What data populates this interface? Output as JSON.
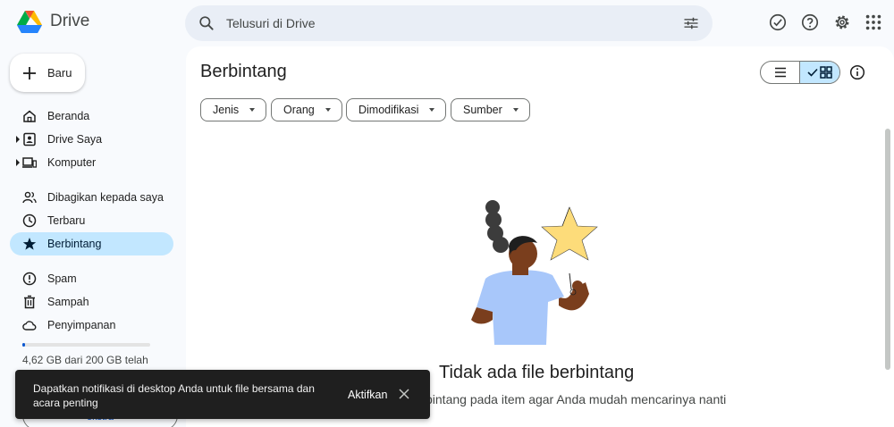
{
  "header": {
    "app_name": "Drive",
    "search_placeholder": "Telusuri di Drive"
  },
  "sidebar": {
    "new_label": "Baru",
    "items": [
      {
        "label": "Beranda"
      },
      {
        "label": "Drive Saya"
      },
      {
        "label": "Komputer"
      },
      {
        "label": "Dibagikan kepada saya"
      },
      {
        "label": "Terbaru"
      },
      {
        "label": "Berbintang"
      },
      {
        "label": "Spam"
      },
      {
        "label": "Sampah"
      },
      {
        "label": "Penyimpanan"
      }
    ],
    "storage_text": "4,62 GB dari 200 GB telah",
    "storage_fraction": 0.023,
    "extra_label": "ekstra"
  },
  "main": {
    "title": "Berbintang",
    "filters": [
      "Jenis",
      "Orang",
      "Dimodifikasi",
      "Sumber"
    ],
    "empty_title": "Tidak ada file berbintang",
    "empty_subtitle": "bintang pada item agar Anda mudah mencarinya nanti"
  },
  "snackbar": {
    "message": "Dapatkan notifikasi di desktop Anda untuk file bersama dan acara penting",
    "action": "Aktifkan"
  },
  "colors": {
    "accent": "#0b57d0",
    "active_nav": "#c2e7ff",
    "background": "#f8fafd"
  }
}
